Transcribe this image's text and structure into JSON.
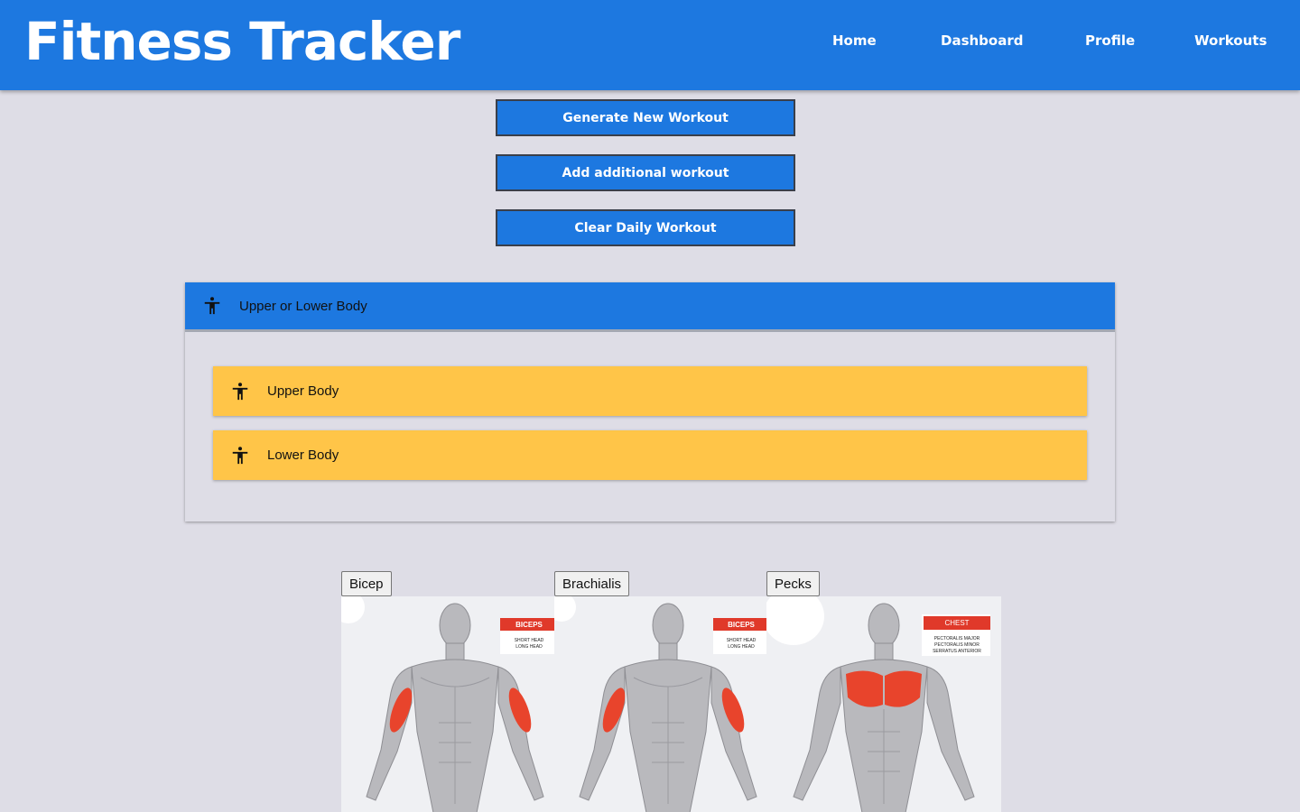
{
  "header": {
    "title": "Fitness Tracker",
    "nav": [
      "Home",
      "Dashboard",
      "Profile",
      "Workouts"
    ]
  },
  "actions": {
    "generate": "Generate New Workout",
    "add": "Add additional workout",
    "clear": "Clear Daily Workout"
  },
  "accordion": {
    "title": "Upper or Lower Body",
    "items": [
      "Upper Body",
      "Lower Body"
    ]
  },
  "muscles": [
    {
      "button": "Bicep",
      "label_title": "BICEPS",
      "label_lines": [
        "SHORT HEAD",
        "LONG HEAD"
      ]
    },
    {
      "button": "Brachialis",
      "label_title": "BICEPS",
      "label_lines": [
        "SHORT HEAD",
        "LONG HEAD"
      ]
    },
    {
      "button": "Pecks",
      "label_title": "CHEST",
      "label_lines": [
        "PECTORALIS MAJOR",
        "PECTORALIS MINOR",
        "SERRATUS ANTERIOR"
      ]
    }
  ],
  "colors": {
    "primary": "#1d78e0",
    "accent": "#ffc548",
    "background": "#dedde6",
    "highlight_muscle": "#e8442c"
  }
}
